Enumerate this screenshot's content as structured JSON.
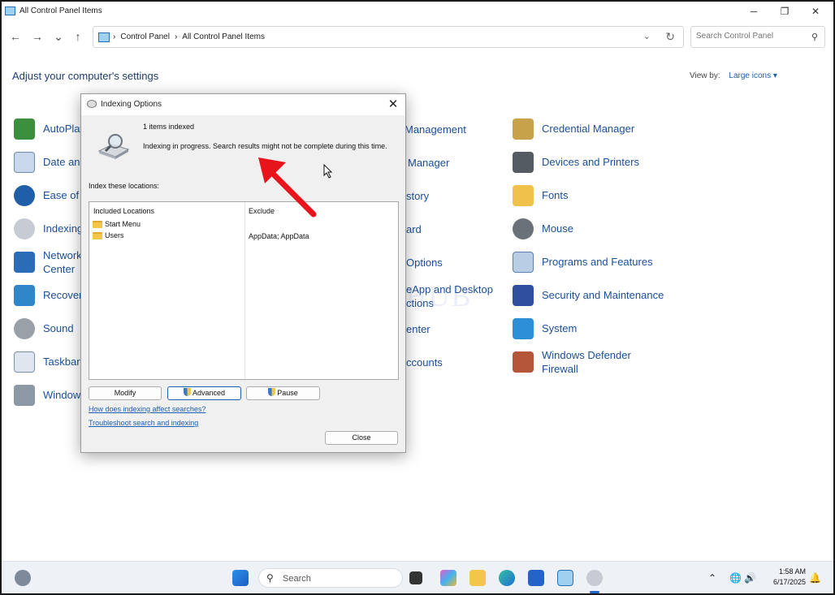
{
  "window": {
    "title": "All Control Panel Items",
    "minimize": "─",
    "maximize": "❐",
    "close": "✕"
  },
  "nav": {
    "back": "←",
    "forward": "→",
    "recent": "⌄",
    "up": "↑",
    "breadcrumbs": [
      "Control Panel",
      "All Control Panel Items"
    ],
    "separator": "›",
    "search_placeholder": "Search Control Panel"
  },
  "header": {
    "heading": "Adjust your computer's settings",
    "view_by_label": "View by:",
    "view_by_value": "Large icons ▾"
  },
  "items_left": [
    {
      "label": "AutoPlay",
      "visible": "AutoPlay"
    },
    {
      "label": "Date and Time",
      "visible": "Date and"
    },
    {
      "label": "Ease of Access Center",
      "visible": "Ease of A"
    },
    {
      "label": "Indexing Options",
      "visible": "Indexing"
    },
    {
      "label": "Network and Sharing Center",
      "visible_line1": "Network",
      "visible_line2": "Center"
    },
    {
      "label": "Recovery",
      "visible": "Recover"
    },
    {
      "label": "Sound",
      "visible": "Sound"
    },
    {
      "label": "Taskbar and Navigation",
      "visible": "Taskbar a"
    },
    {
      "label": "Windows Tools",
      "visible": "Window"
    }
  ],
  "items_middle_fragments": [
    "Management",
    "Manager",
    "story",
    "ard",
    "Options",
    "eApp and Desktop",
    "ctions",
    "enter",
    "ccounts"
  ],
  "items_right": [
    {
      "label": "Credential Manager"
    },
    {
      "label": "Devices and Printers"
    },
    {
      "label": "Fonts"
    },
    {
      "label": "Mouse"
    },
    {
      "label": "Programs and Features"
    },
    {
      "label": "Security and Maintenance"
    },
    {
      "label": "System"
    },
    {
      "label_line1": "Windows Defender",
      "label_line2": "Firewall"
    }
  ],
  "watermark": "IT Pros HUB",
  "dialog": {
    "title": "Indexing Options",
    "close": "✕",
    "items_indexed": "1 items indexed",
    "status": "Indexing in progress. Search results might not be complete during this time.",
    "index_label": "Index these locations:",
    "col_included": "Included Locations",
    "col_exclude": "Exclude",
    "locations": [
      {
        "name": "Start Menu",
        "exclude": ""
      },
      {
        "name": "Users",
        "exclude": "AppData; AppData"
      }
    ],
    "buttons": {
      "modify": "Modify",
      "advanced": "Advanced",
      "pause": "Pause",
      "close": "Close"
    },
    "links": {
      "how": "How does indexing affect searches?",
      "troubleshoot": "Troubleshoot search and indexing"
    }
  },
  "annotation_color": "#e8141b",
  "taskbar": {
    "search_label": "Search",
    "time": "1:58 AM",
    "date": "6/17/2025",
    "tray_chevron": "⌃",
    "tray_globe": "🌐",
    "tray_volume": "🔊",
    "tray_bell": "🔔"
  }
}
